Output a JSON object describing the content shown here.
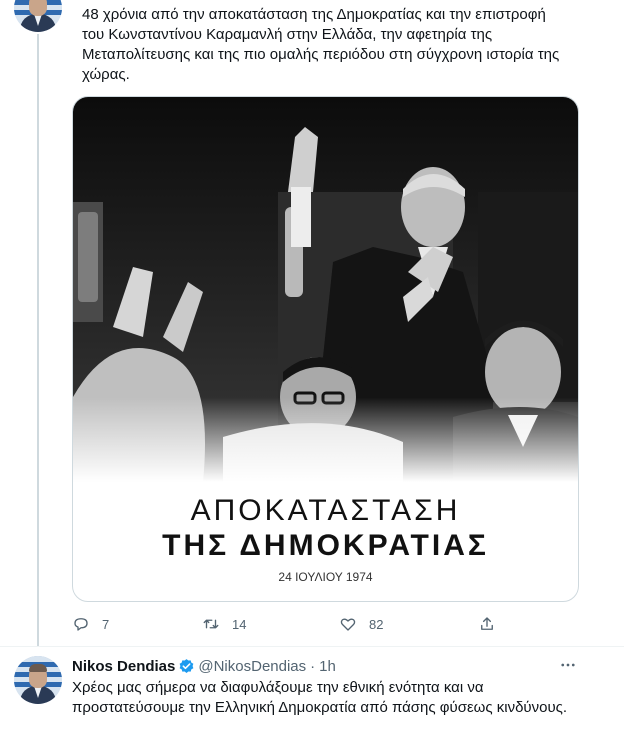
{
  "tweet1": {
    "text": "48 χρόνια από την αποκατάσταση της Δημοκρατίας και την επιστροφή\nτου Κωνσταντίνου Καραμανλή στην Ελλάδα, την αφετηρία της\nΜεταπολίτευσης και της πιο ομαλής περιόδου στη σύγχρονη ιστορία της\nχώρας.",
    "media": {
      "title_line1": "ΑΠΟΚΑΤΑΣΤΑΣΗ",
      "title_line2": "ΤΗΣ ΔΗΜΟΚΡΑΤΙΑΣ",
      "date": "24 ΙΟΥΛΙΟΥ 1974"
    },
    "actions": {
      "replies": "7",
      "retweets": "14",
      "likes": "82"
    }
  },
  "tweet2": {
    "name": "Nikos Dendias",
    "handle": "@NikosDendias",
    "separator": "·",
    "time": "1h",
    "text": "Χρέος μας σήμερα να διαφυλάξουμε την εθνική ενότητα  και να\nπροστατεύσουμε την Ελληνική Δημοκρατία από πάσης φύσεως κινδύνους."
  },
  "colors": {
    "text": "#0f1419",
    "secondary": "#536471",
    "verified": "#1d9bf0",
    "border": "#cfd9de"
  },
  "icons": [
    "reply-icon",
    "retweet-icon",
    "like-icon",
    "share-icon",
    "verified-badge-icon",
    "more-icon"
  ]
}
